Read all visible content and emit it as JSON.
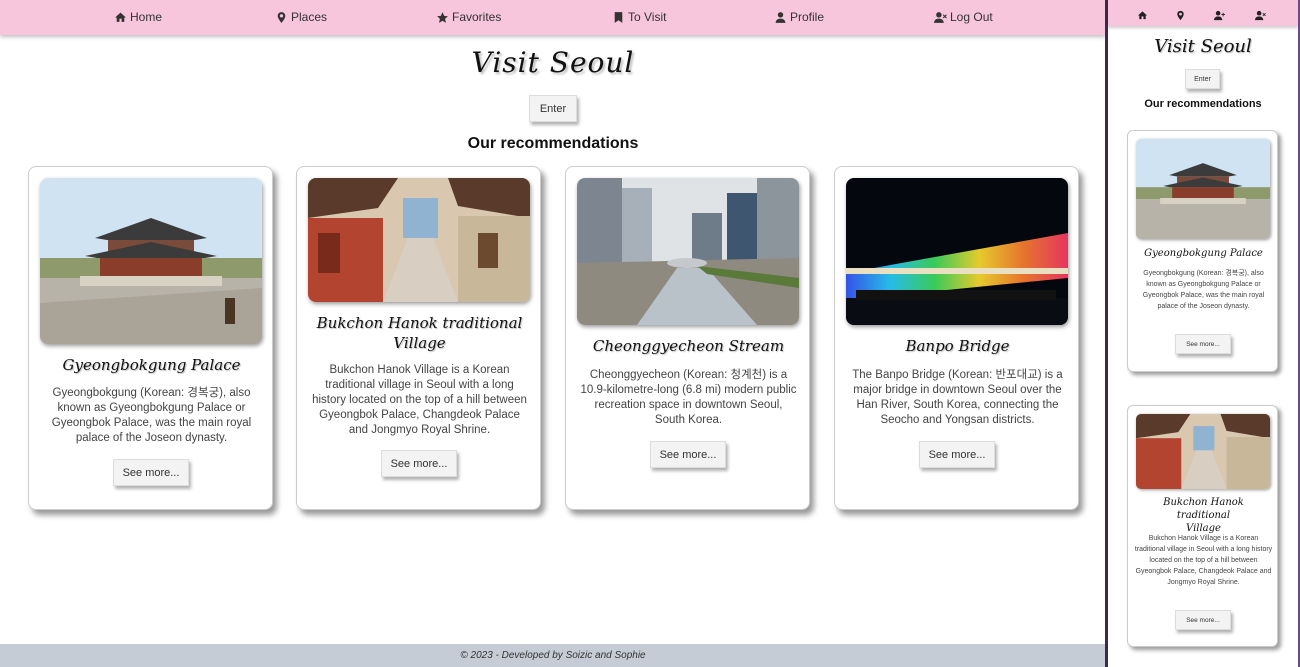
{
  "nav": {
    "items": [
      {
        "label": "Home",
        "icon": "home-icon"
      },
      {
        "label": "Places",
        "icon": "map-pin-icon"
      },
      {
        "label": "Favorites",
        "icon": "star-icon"
      },
      {
        "label": "To Visit",
        "icon": "bookmark-icon"
      },
      {
        "label": "Profile",
        "icon": "user-icon"
      },
      {
        "label": "Log Out",
        "icon": "user-x-icon"
      }
    ]
  },
  "hero": {
    "title": "Visit Seoul",
    "enter_label": "Enter",
    "recommendations_heading": "Our recommendations"
  },
  "cards": [
    {
      "title": "Gyeongbokgung Palace",
      "description": "Gyeongbokgung (Korean: 경복궁), also known as Gyeongbokgung Palace or Gyeongbok Palace, was the main royal palace of the Joseon dynasty.",
      "button": "See more..."
    },
    {
      "title": "Bukchon Hanok traditional Village",
      "description": "Bukchon Hanok Village is a Korean traditional village in Seoul with a long history located on the top of a hill between Gyeongbok Palace, Changdeok Palace and Jongmyo Royal Shrine.",
      "button": "See more..."
    },
    {
      "title": "Cheonggyecheon Stream",
      "description": "Cheonggyecheon (Korean: 청계천) is a 10.9-kilometre-long (6.8 mi) modern public recreation space in downtown Seoul, South Korea.",
      "button": "See more..."
    },
    {
      "title": "Banpo Bridge",
      "description": "The Banpo Bridge (Korean: 반포대교) is a major bridge in downtown Seoul over the Han River, South Korea, connecting the Seocho and Yongsan districts.",
      "button": "See more..."
    }
  ],
  "footer": {
    "text": "© 2023 - Developed by Soizic and Sophie"
  },
  "mobile": {
    "nav_icons": [
      "home-icon",
      "map-pin-icon",
      "user-plus-icon",
      "user-x-icon"
    ],
    "title": "Visit Seoul",
    "enter_label": "Enter",
    "recommendations_heading": "Our recommendations",
    "cards": [
      {
        "title": "Gyeongbokgung Palace",
        "description": "Gyeongbokgung (Korean: 경복궁), also known as Gyeongbokgung Palace or Gyeongbok Palace, was the main royal palace of the Joseon dynasty.",
        "button": "See more..."
      },
      {
        "title": "Bukchon Hanok traditional Village",
        "description": "Bukchon Hanok Village is a Korean traditional village in Seoul with a long history located on the top of a hill between Gyeongbok Palace, Changdeok Palace and Jongmyo Royal Shrine.",
        "button": "See more..."
      }
    ]
  },
  "colors": {
    "nav_background": "#f7c6dc",
    "footer_background": "#c6ccd6",
    "divider": "#3b2a4c"
  }
}
